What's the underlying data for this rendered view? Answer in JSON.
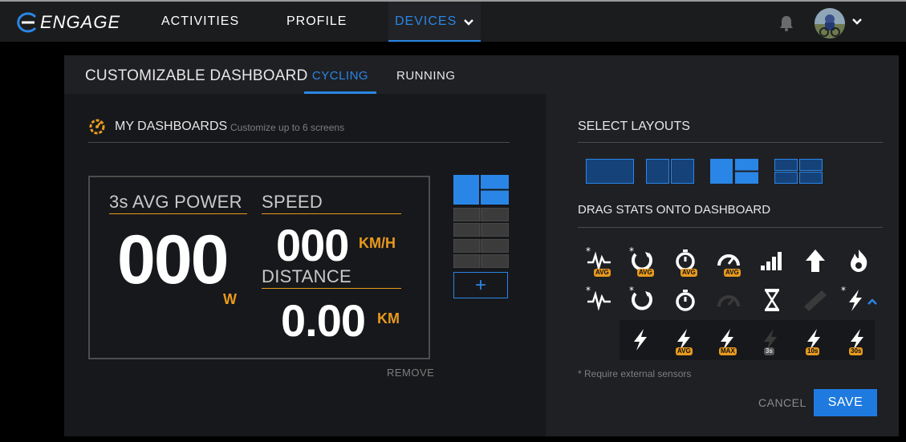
{
  "nav": {
    "brand": "ENGAGE",
    "items": [
      {
        "label": "ACTIVITIES"
      },
      {
        "label": "PROFILE"
      },
      {
        "label": "DEVICES"
      }
    ],
    "icons": {
      "bell": "bell-icon",
      "avatar_chevron": "chevron-down-icon"
    }
  },
  "panel": {
    "title": "CUSTOMIZABLE DASHBOARD",
    "tabs": [
      {
        "label": "CYCLING",
        "active": true
      },
      {
        "label": "RUNNING",
        "active": false
      }
    ]
  },
  "dashboards": {
    "title": "MY DASHBOARDS",
    "subtitle": "Customize up to 6 screens",
    "preview": {
      "power_label": "3s AVG POWER",
      "power_value": "000",
      "power_unit": "W",
      "speed_label": "SPEED",
      "speed_value": "000",
      "speed_unit": "KM/H",
      "distance_label": "DISTANCE",
      "distance_value": "0.00",
      "distance_unit": "KM"
    },
    "remove_label": "REMOVE",
    "add_label": "+"
  },
  "layouts": {
    "title": "SELECT LAYOUTS",
    "options": [
      "single",
      "two-column",
      "one-plus-two",
      "four-grid"
    ],
    "selected": "one-plus-two"
  },
  "stats": {
    "title": "DRAG STATS ONTO DASHBOARD",
    "row1": [
      {
        "icon": "heart-rate-avg-icon",
        "badge": "AVG",
        "sensor": true
      },
      {
        "icon": "cadence-avg-icon",
        "badge": "AVG",
        "sensor": true
      },
      {
        "icon": "timer-avg-icon",
        "badge": "AVG",
        "sensor": false
      },
      {
        "icon": "speedometer-avg-icon",
        "badge": "AVG",
        "sensor": false
      },
      {
        "icon": "gradient-icon",
        "badge": "",
        "sensor": false
      },
      {
        "icon": "elevation-arrow-icon",
        "badge": "",
        "sensor": false
      },
      {
        "icon": "calories-flame-icon",
        "badge": "",
        "sensor": false
      }
    ],
    "row2": [
      {
        "icon": "heart-rate-icon",
        "sensor": true
      },
      {
        "icon": "cadence-icon",
        "sensor": true
      },
      {
        "icon": "timer-icon",
        "sensor": false
      },
      {
        "icon": "speedometer-icon",
        "sensor": false,
        "disabled": true
      },
      {
        "icon": "hourglass-icon",
        "sensor": false
      },
      {
        "icon": "ruler-icon",
        "sensor": false,
        "disabled": true
      },
      {
        "icon": "power-icon",
        "sensor": true
      }
    ],
    "power_sub": [
      {
        "icon": "power-icon",
        "badge": ""
      },
      {
        "icon": "power-avg-icon",
        "badge": "AVG"
      },
      {
        "icon": "power-max-icon",
        "badge": "MAX"
      },
      {
        "icon": "power-3s-icon",
        "badge": "3s",
        "disabled": true
      },
      {
        "icon": "power-10s-icon",
        "badge": "10s"
      },
      {
        "icon": "power-30s-icon",
        "badge": "30s"
      }
    ],
    "sensor_mark": "*",
    "footnote": "* Require external sensors"
  },
  "actions": {
    "cancel": "CANCEL",
    "save": "SAVE"
  },
  "colors": {
    "accent": "#2a86e6",
    "orange": "#e89a1f",
    "panel_bg": "#1a1b1f"
  }
}
